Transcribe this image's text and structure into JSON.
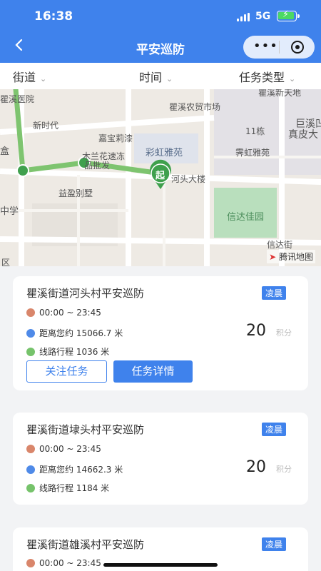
{
  "status_bar": {
    "time": "16:38",
    "network": "5G"
  },
  "nav": {
    "back_icon": "chevron-left-icon",
    "title": "平安巡防",
    "more_icon": "more-dots-icon",
    "close_icon": "circle-target-icon"
  },
  "filters": [
    {
      "label": "街道"
    },
    {
      "label": "时间"
    },
    {
      "label": "任务类型"
    }
  ],
  "map": {
    "labels": {
      "hospital": "瞿溪医院",
      "pet": "新时代",
      "jiabao": "嘉宝莉漆",
      "mulan": "木兰花速冻",
      "mulan2": "品批发",
      "nongmao": "瞿溪农贸市场",
      "caihong": "彩虹雅苑",
      "shiyi": "11栋",
      "jiedao": "巨溪凹",
      "zhenpi": "真皮大",
      "jihong": "霁虹雅苑",
      "yiying": "益盈别墅",
      "hetou": "河头大楼",
      "xinda_garden": "信达佳园",
      "xinda_street": "信达街",
      "middle_school": "中学",
      "he": "盒",
      "qu": "区",
      "top_left_frag": "瞿溪新天地",
      "start_marker": "起",
      "watermark": "腾讯地图"
    },
    "route_color": "#7ec46f",
    "start_color": "#3fa04d"
  },
  "tasks": [
    {
      "title": "瞿溪街道河头村平安巡防",
      "tag": "凌晨",
      "time_range": "00:00 ~ 23:45",
      "distance": "距离您约 15066.7 米",
      "route_length": "线路行程 1036 米",
      "points": "20",
      "points_unit": "积分",
      "follow_label": "关注任务",
      "detail_label": "任务详情"
    },
    {
      "title": "瞿溪街道埭头村平安巡防",
      "tag": "凌晨",
      "time_range": "00:00 ~ 23:45",
      "distance": "距离您约 14662.3 米",
      "route_length": "线路行程 1184 米",
      "points": "20",
      "points_unit": "积分"
    },
    {
      "title": "瞿溪街道雄溪村平安巡防",
      "tag": "凌晨",
      "time_range": "00:00 ~ 23:45"
    }
  ],
  "colors": {
    "primary": "#3f82ec",
    "background": "#f2f3f5"
  }
}
